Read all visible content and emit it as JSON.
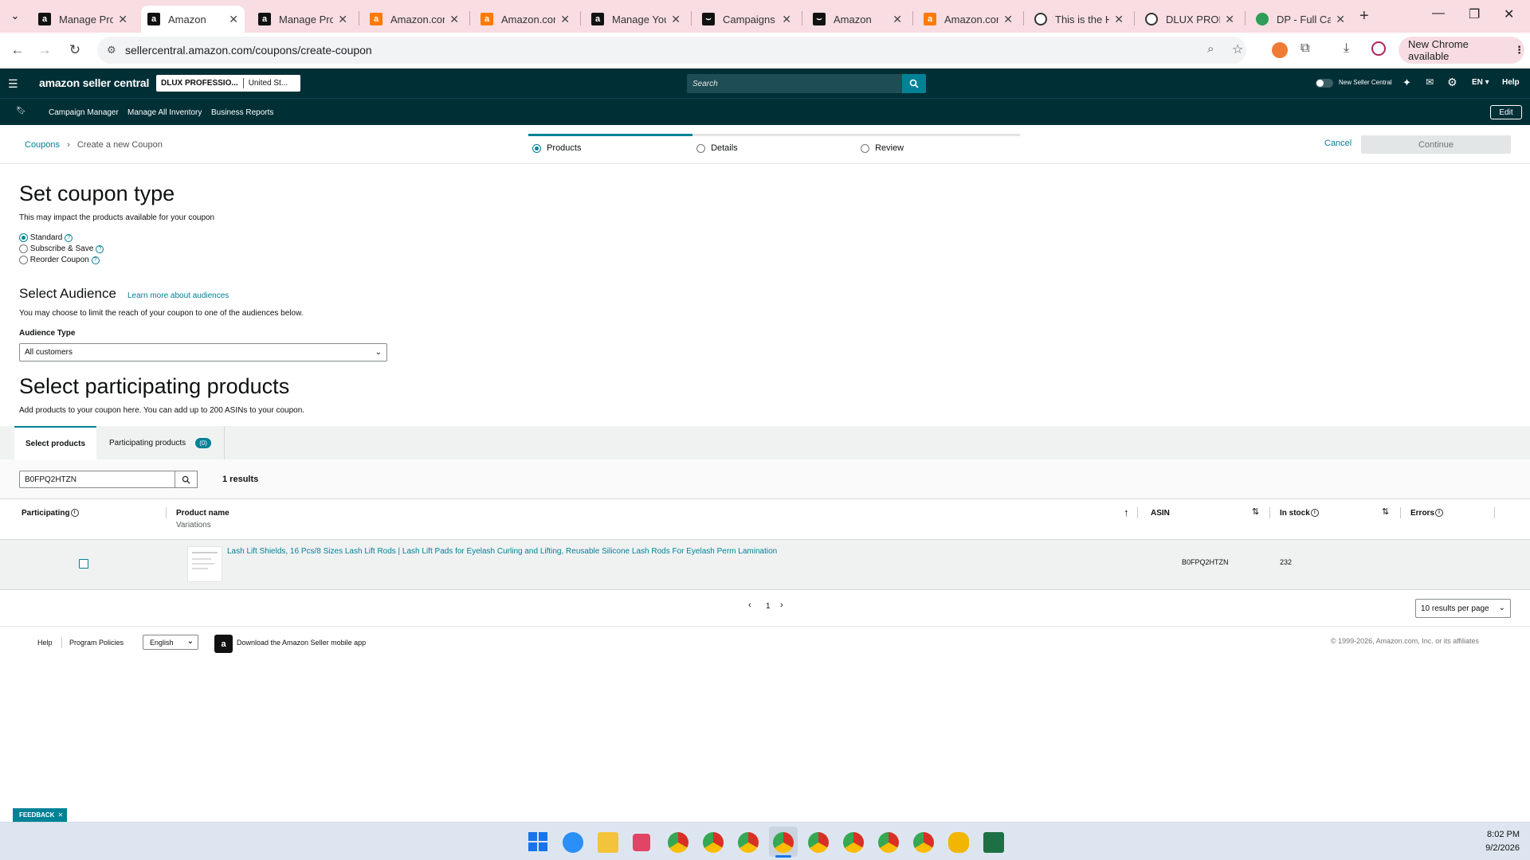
{
  "browser": {
    "tabs": [
      {
        "title": "Manage Pro",
        "icon": "amazon-icon"
      },
      {
        "title": "Amazon",
        "icon": "amazon-icon",
        "active": true
      },
      {
        "title": "Manage Pro",
        "icon": "amazon-icon"
      },
      {
        "title": "Amazon.com",
        "icon": "amazon-orange-icon"
      },
      {
        "title": "Amazon.com",
        "icon": "amazon-orange-icon"
      },
      {
        "title": "Manage You",
        "icon": "amazon-icon"
      },
      {
        "title": "Campaigns |",
        "icon": "amazon-ads-icon"
      },
      {
        "title": "Amazon",
        "icon": "amazon-ads-icon"
      },
      {
        "title": "Amazon.com",
        "icon": "amazon-orange-icon"
      },
      {
        "title": "This is the H",
        "icon": "circle-icon"
      },
      {
        "title": "DLUX PROFE",
        "icon": "circle-icon"
      },
      {
        "title": "DP - Full Car",
        "icon": "green-icon"
      }
    ],
    "url": "sellercentral.amazon.com/coupons/create-coupon",
    "new_chrome": "New Chrome available"
  },
  "header": {
    "logo": "amazon seller central",
    "account": "DLUX PROFESSIO...",
    "marketplace": "United St...",
    "search_placeholder": "Search",
    "new_seller_central": "New Seller Central",
    "language": "EN",
    "help": "Help"
  },
  "subnav": {
    "links": [
      "Campaign Manager",
      "Manage All Inventory",
      "Business Reports"
    ],
    "edit": "Edit"
  },
  "breadcrumb": {
    "root": "Coupons",
    "current": "Create a new Coupon"
  },
  "steps": [
    "Products",
    "Details",
    "Review"
  ],
  "actions": {
    "cancel": "Cancel",
    "continue": "Continue"
  },
  "coupon_type": {
    "title": "Set coupon type",
    "subtitle": "This may impact the products available for your coupon",
    "options": [
      "Standard",
      "Subscribe & Save",
      "Reorder Coupon"
    ],
    "selected": "Standard"
  },
  "audience": {
    "title": "Select Audience",
    "learn_more": "Learn more about audiences",
    "subtitle": "You may choose to limit the reach of your coupon to one of the audiences below.",
    "label": "Audience Type",
    "value": "All customers"
  },
  "products": {
    "title": "Select participating products",
    "subtitle": "Add products to your coupon here. You can add up to 200 ASINs to your coupon.",
    "tabs": {
      "select": "Select products",
      "participating": "Participating products",
      "count": "(0)"
    },
    "search_value": "B0FPQ2HTZN",
    "results": "1 results",
    "columns": {
      "participating": "Participating",
      "product_name": "Product name",
      "variations": "Variations",
      "asin": "ASIN",
      "in_stock": "In stock",
      "errors": "Errors"
    },
    "rows": [
      {
        "name": "Lash Lift Shields, 16 Pcs/8 Sizes Lash Lift Rods | Lash Lift Pads for Eyelash Curling and Lifting, Reusable Silicone Lash Rods For Eyelash Perm Lamination",
        "asin": "B0FPQ2HTZN",
        "in_stock": "232"
      }
    ],
    "page": "1",
    "per_page": "10 results per page"
  },
  "footer": {
    "help": "Help",
    "policies": "Program Policies",
    "language": "English",
    "app": "Download the Amazon Seller mobile app",
    "copyright": "© 1999-2026, Amazon.com, Inc. or its affiliates"
  },
  "feedback": "FEEDBACK",
  "taskbar": {
    "time": "8:02 PM",
    "date": "9/2/2026"
  }
}
